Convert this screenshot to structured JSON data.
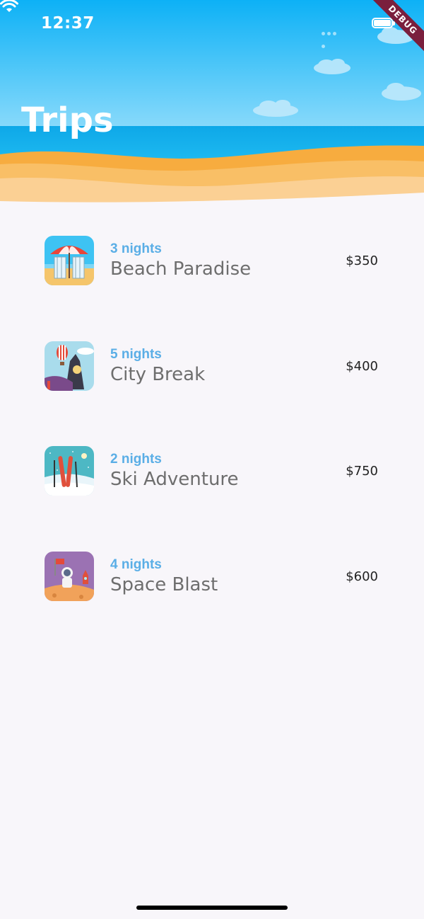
{
  "status_bar": {
    "time": "12:37"
  },
  "debug_banner": "DEBUG",
  "header": {
    "title": "Trips"
  },
  "colors": {
    "sky": "#22b7f2",
    "sand": "#f7b34a",
    "nights": "#5aaee6",
    "background": "#f8f6fa"
  },
  "trips": [
    {
      "nights": "3 nights",
      "name": "Beach Paradise",
      "price": "$350",
      "icon": "beach-umbrella-image"
    },
    {
      "nights": "5 nights",
      "name": "City Break",
      "price": "$400",
      "icon": "big-ben-balloon-image"
    },
    {
      "nights": "2 nights",
      "name": "Ski Adventure",
      "price": "$750",
      "icon": "skis-image"
    },
    {
      "nights": "4 nights",
      "name": "Space Blast",
      "price": "$600",
      "icon": "astronaut-image"
    }
  ]
}
